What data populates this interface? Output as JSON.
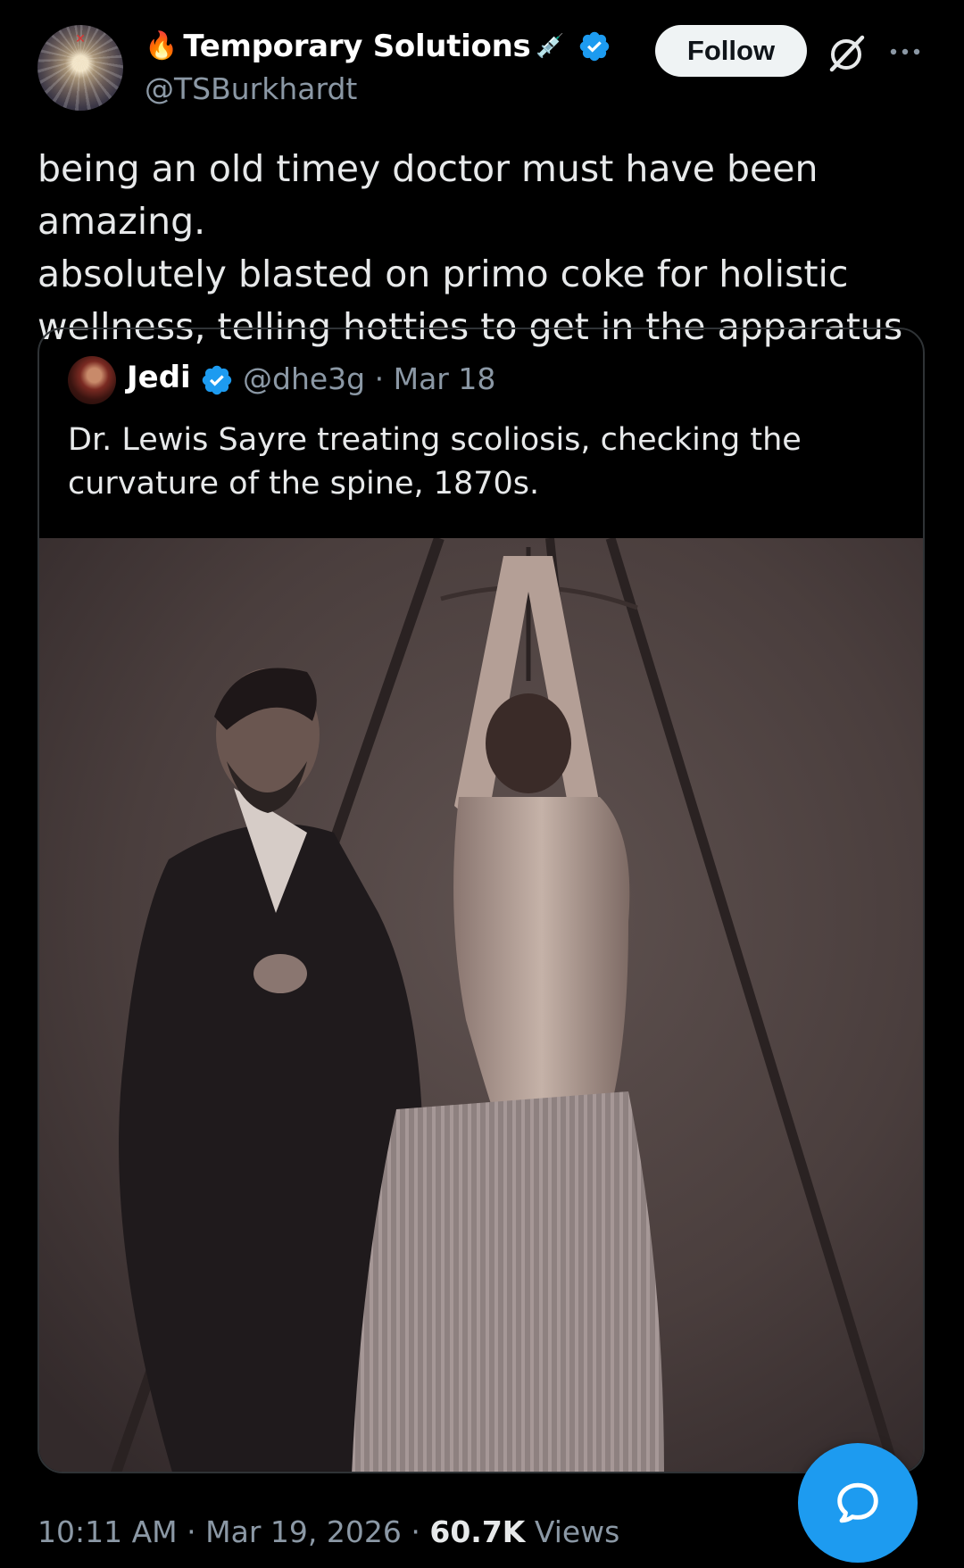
{
  "author": {
    "name": "Temporary Solutions",
    "handle": "@TSBurkhardt",
    "name_emoji_left": "🔥",
    "name_emoji_right": "💉",
    "verified": true
  },
  "follow_label": "Follow",
  "tweet": {
    "text": "being an old timey doctor must have been amazing.\nabsolutely blasted on primo coke for holistic\nwellness, telling hotties to get in the apparatus"
  },
  "quote": {
    "name": "Jedi",
    "handle": "@dhe3g",
    "separator": "·",
    "date": "Mar 18",
    "text": "Dr. Lewis Sayre treating scoliosis, checking the curvature of the spine, 1870s."
  },
  "footer": {
    "time": "10:11 AM",
    "date": "Mar 19, 2026",
    "views_count": "60.7K",
    "views_label": "Views",
    "separator": "·"
  },
  "colors": {
    "background": "#000000",
    "text_primary": "#e7e9ea",
    "text_secondary": "#8b98a5",
    "accent": "#1d9bf0",
    "border": "#2f3336"
  },
  "icons": [
    "verified-badge-icon",
    "grok-icon",
    "more-icon",
    "reply-fab-icon"
  ]
}
